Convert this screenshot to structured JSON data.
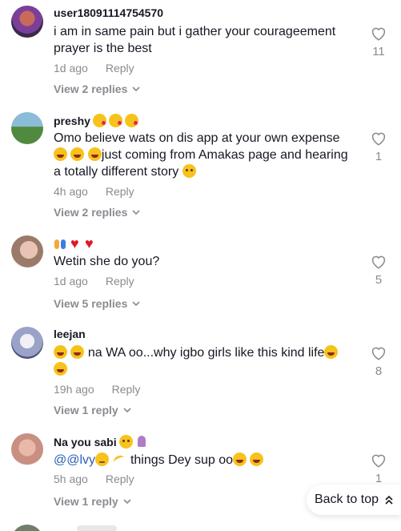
{
  "comments": [
    {
      "username": "user18091114754570",
      "text": "i am in same pain but i gather your courageement prayer is the best",
      "time": "1d ago",
      "reply_label": "Reply",
      "likes": "11",
      "view_replies": "View 2 replies"
    },
    {
      "username": "preshy",
      "text_main": "Omo believe wats on dis app at your own expense",
      "text_after": "just coming from Amakas page and hearing a totally different story",
      "time": "4h ago",
      "reply_label": "Reply",
      "likes": "1",
      "view_replies": "View 2 replies"
    },
    {
      "username": "",
      "text": "Wetin she do you?",
      "time": "1d ago",
      "reply_label": "Reply",
      "likes": "5",
      "view_replies": "View 5 replies"
    },
    {
      "username": "leejan",
      "text": "na WA oo...why igbo girls like this kind life",
      "time": "19h ago",
      "reply_label": "Reply",
      "likes": "8",
      "view_replies": "View 1 reply"
    },
    {
      "username": "Na you sabi",
      "mention": "@@lvy",
      "text": "things Dey sup oo",
      "time": "5h ago",
      "reply_label": "Reply",
      "likes": "1",
      "view_replies": "View 1 reply"
    }
  ],
  "back_to_top": "Back to top",
  "colors": {
    "text": "#161823",
    "muted": "#8a8b91",
    "mention": "#2b5db9",
    "emoji_yellow": "#f7c21b"
  }
}
